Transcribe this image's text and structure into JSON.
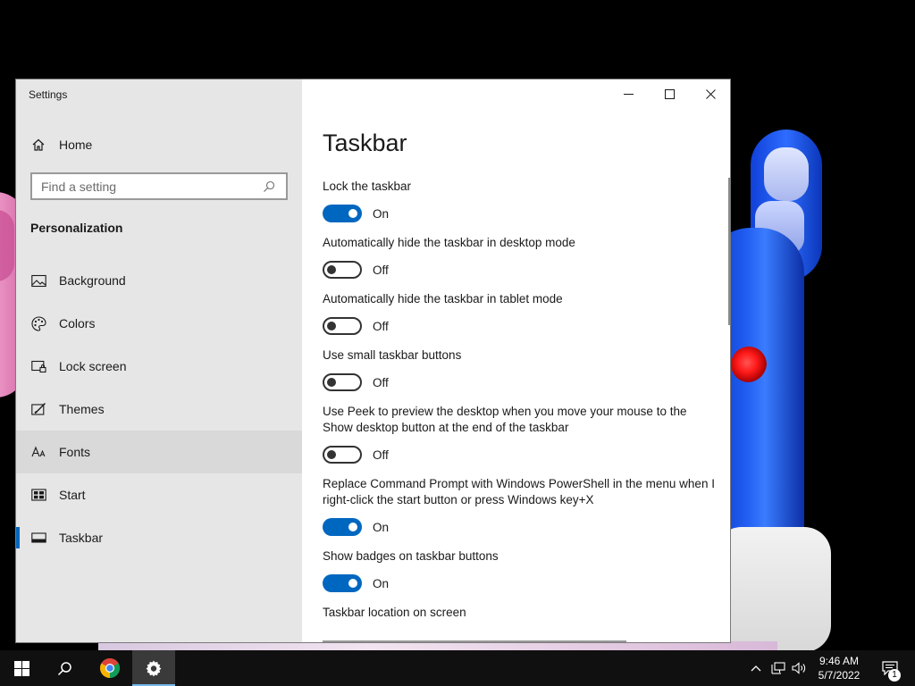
{
  "window": {
    "app_title": "Settings"
  },
  "sidebar": {
    "home_label": "Home",
    "search_placeholder": "Find a setting",
    "section_title": "Personalization",
    "items": [
      {
        "label": "Background",
        "icon": "background-icon"
      },
      {
        "label": "Colors",
        "icon": "colors-icon"
      },
      {
        "label": "Lock screen",
        "icon": "lock-screen-icon"
      },
      {
        "label": "Themes",
        "icon": "themes-icon"
      },
      {
        "label": "Fonts",
        "icon": "fonts-icon"
      },
      {
        "label": "Start",
        "icon": "start-icon"
      },
      {
        "label": "Taskbar",
        "icon": "taskbar-icon"
      }
    ],
    "hovered_item": "Fonts",
    "active_item": "Taskbar"
  },
  "main": {
    "title": "Taskbar",
    "settings": [
      {
        "label": "Lock the taskbar",
        "state": "On"
      },
      {
        "label": "Automatically hide the taskbar in desktop mode",
        "state": "Off"
      },
      {
        "label": "Automatically hide the taskbar in tablet mode",
        "state": "Off"
      },
      {
        "label": "Use small taskbar buttons",
        "state": "Off"
      },
      {
        "label": "Use Peek to preview the desktop when you move your mouse to the Show desktop button at the end of the taskbar",
        "state": "Off"
      },
      {
        "label": "Replace Command Prompt with Windows PowerShell in the menu when I right-click the start button or press Windows key+X",
        "state": "On"
      },
      {
        "label": "Show badges on taskbar buttons",
        "state": "On"
      }
    ],
    "location_label": "Taskbar location on screen"
  },
  "taskbar": {
    "time": "9:46 AM",
    "date": "5/7/2022",
    "notification_count": "1",
    "pinned": [
      "start-icon",
      "search-icon",
      "chrome-icon",
      "settings-gear-icon"
    ]
  },
  "colors": {
    "accent": "#0067c0",
    "sidebar_bg": "#e6e6e6",
    "taskbar_bg": "#101010"
  }
}
